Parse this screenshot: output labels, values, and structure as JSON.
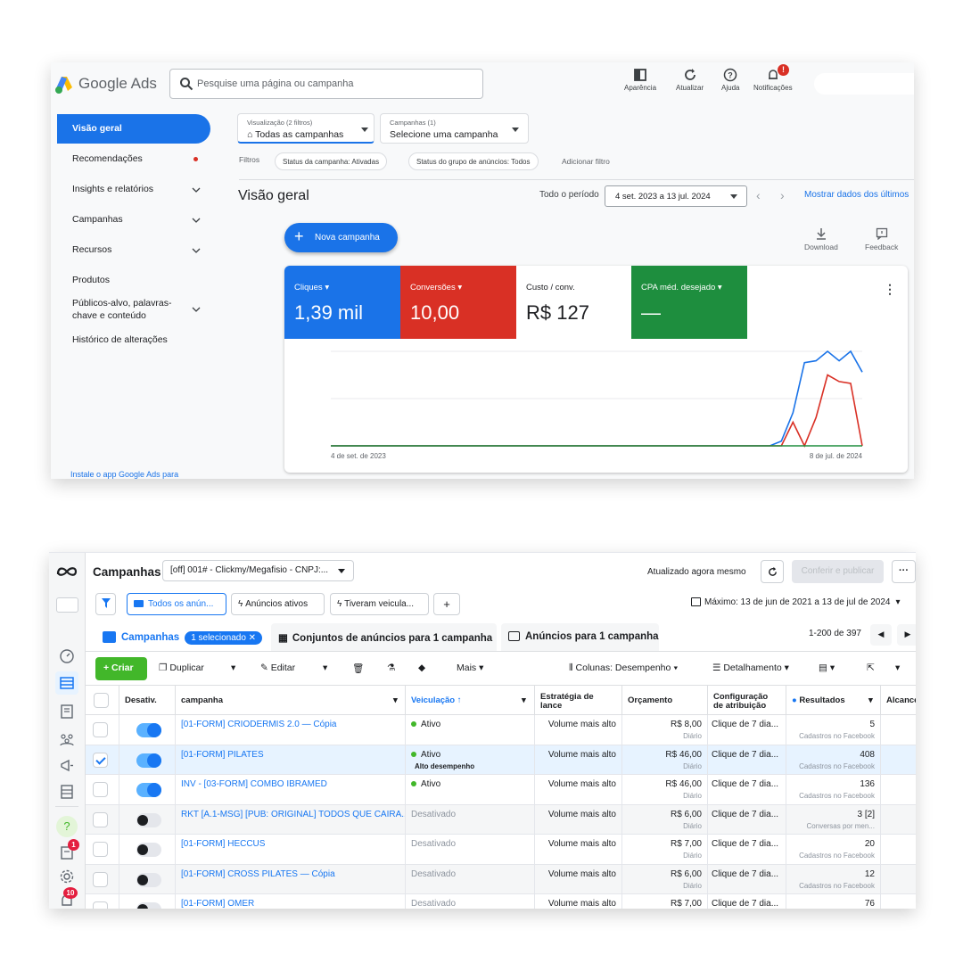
{
  "google_ads": {
    "brand": "Google Ads",
    "search_placeholder": "Pesquise uma página ou campanha",
    "topbar": {
      "appearance": "Aparência",
      "refresh": "Atualizar",
      "help": "Ajuda",
      "notifications": "Notificações",
      "notifications_badge": "!"
    },
    "sidebar": {
      "active": "Visão geral",
      "items": [
        "Recomendações",
        "Insights e relatórios",
        "Campanhas",
        "Recursos",
        "Produtos",
        "Públicos-alvo, palavras-",
        "chave e conteúdo",
        "Histórico de alterações"
      ],
      "install": "Instale o app Google Ads para"
    },
    "filters": {
      "view_small": "Visualização (2 filtros)",
      "view_value": "Todas as campanhas",
      "campaigns_small": "Campanhas (1)",
      "campaigns_value": "Selecione uma campanha",
      "label": "Filtros",
      "chip1": "Status da campanha: Ativadas",
      "chip2": "Status do grupo de anúncios: Todos",
      "add": "Adicionar filtro"
    },
    "page_title": "Visão geral",
    "period_label": "Todo o período",
    "date_range": "4 set. 2023 a 13 jul. 2024",
    "show_data": "Mostrar dados dos últimos",
    "new_campaign": "Nova campanha",
    "download": "Download",
    "feedback": "Feedback",
    "metrics": [
      {
        "label": "Cliques ▾",
        "value": "1,39 mil",
        "bg": "#1a73e8",
        "fg": "#ffffff"
      },
      {
        "label": "Conversões ▾",
        "value": "10,00",
        "bg": "#d93025",
        "fg": "#ffffff"
      },
      {
        "label": "Custo / conv.",
        "value": "R$ 127",
        "bg": "#ffffff",
        "fg": "#202124"
      },
      {
        "label": "CPA méd. desejado ▾",
        "value": "—",
        "bg": "#1e8e3e",
        "fg": "#ffffff"
      }
    ],
    "chart_data": {
      "type": "line",
      "x_start_label": "4 de set. de 2023",
      "x_end_label": "8 de jul. de 2024",
      "series": [
        {
          "color": "#1a73e8",
          "values": [
            0,
            0,
            0,
            0,
            0,
            0,
            0,
            0,
            0,
            0,
            0,
            0,
            0,
            0,
            0,
            0,
            0,
            0,
            0,
            0,
            0,
            0,
            0,
            0,
            0,
            0,
            0,
            0,
            0,
            0,
            0,
            0,
            0,
            0,
            0,
            0,
            0,
            0,
            0,
            0.05,
            0.35,
            0.88,
            0.9,
            1.0,
            0.9,
            1.0,
            0.78
          ]
        },
        {
          "color": "#d93025",
          "values": [
            0,
            0,
            0,
            0,
            0,
            0,
            0,
            0,
            0,
            0,
            0,
            0,
            0,
            0,
            0,
            0,
            0,
            0,
            0,
            0,
            0,
            0,
            0,
            0,
            0,
            0,
            0,
            0,
            0,
            0,
            0,
            0,
            0,
            0,
            0,
            0,
            0,
            0,
            0,
            0,
            0.25,
            0.0,
            0.3,
            0.75,
            0.68,
            0.66,
            0.0
          ]
        },
        {
          "color": "#1e8e3e",
          "values": [
            0,
            0,
            0,
            0,
            0,
            0,
            0,
            0,
            0,
            0,
            0,
            0,
            0,
            0,
            0,
            0,
            0,
            0,
            0,
            0,
            0,
            0,
            0,
            0,
            0,
            0,
            0,
            0,
            0,
            0,
            0,
            0,
            0,
            0,
            0,
            0,
            0,
            0,
            0,
            0,
            0,
            0,
            0,
            0,
            0,
            0,
            0
          ]
        }
      ]
    }
  },
  "meta": {
    "title": "Campanhas",
    "account": "[off] 001# - Clickmy/Megafisio - CNPJ:...",
    "updated": "Atualizado agora mesmo",
    "publish": "Conferir e publicar",
    "more": "···",
    "filter_buttons": [
      "Todos os anún...",
      "Anúncios ativos",
      "Tiveram veicula..."
    ],
    "add_filter": "+",
    "date_range": "Máximo: 13 de jun de 2021 a 13 de jul de 2024",
    "tabs": {
      "campaigns": "Campanhas",
      "selected": "1 selecionado",
      "adsets": "Conjuntos de anúncios para 1 campanha",
      "ads": "Anúncios para 1 campanha"
    },
    "pager": "1-200 de 397",
    "toolbar": {
      "create": "+ Criar",
      "duplicate": "Duplicar",
      "edit": "Editar",
      "more": "Mais",
      "columns": "Colunas: Desempenho",
      "breakdown": "Detalhamento"
    },
    "rail_badges": {
      "notifications": "1",
      "alerts": "10"
    },
    "columns": {
      "off": "Desativ.",
      "campaign": "campanha",
      "delivery": "Veiculação ↑",
      "bid_1": "Estratégia de",
      "bid_2": "lance",
      "budget": "Orçamento",
      "attr_1": "Configuração",
      "attr_2": "de atribuição",
      "results": "Resultados",
      "reach": "Alcance"
    },
    "rows": [
      {
        "name": "[01-FORM] CRIODERMIS 2.0 — Cópia",
        "status": "Ativo",
        "status_sub": "",
        "on": true,
        "checked": false,
        "bid": "Volume mais alto",
        "budget": "R$ 8,00",
        "budget_sub": "Diário",
        "attr": "Clique de 7 dia...",
        "result": "5",
        "result_sub": "Cadastros no Facebook"
      },
      {
        "name": "[01-FORM] PILATES",
        "status": "Ativo",
        "status_sub": "Alto desempenho",
        "on": true,
        "checked": true,
        "bid": "Volume mais alto",
        "budget": "R$ 46,00",
        "budget_sub": "Diário",
        "attr": "Clique de 7 dia...",
        "result": "408",
        "result_sub": "Cadastros no Facebook"
      },
      {
        "name": "INV - [03-FORM] COMBO IBRAMED",
        "status": "Ativo",
        "status_sub": "",
        "on": true,
        "checked": false,
        "bid": "Volume mais alto",
        "budget": "R$ 46,00",
        "budget_sub": "Diário",
        "attr": "Clique de 7 dia...",
        "result": "136",
        "result_sub": "Cadastros no Facebook"
      },
      {
        "name": "RKT [A.1-MSG] [PUB: ORIGINAL] TODOS QUE CAIRA...",
        "status": "Desativado",
        "status_sub": "",
        "on": false,
        "checked": false,
        "bid": "Volume mais alto",
        "budget": "R$ 6,00",
        "budget_sub": "Diário",
        "attr": "Clique de 7 dia...",
        "result": "3 [2]",
        "result_sub": "Conversas por men..."
      },
      {
        "name": "[01-FORM] HECCUS",
        "status": "Desativado",
        "status_sub": "",
        "on": false,
        "checked": false,
        "bid": "Volume mais alto",
        "budget": "R$ 7,00",
        "budget_sub": "Diário",
        "attr": "Clique de 7 dia...",
        "result": "20",
        "result_sub": "Cadastros no Facebook"
      },
      {
        "name": "[01-FORM] CROSS PILATES — Cópia",
        "status": "Desativado",
        "status_sub": "",
        "on": false,
        "checked": false,
        "bid": "Volume mais alto",
        "budget": "R$ 6,00",
        "budget_sub": "Diário",
        "attr": "Clique de 7 dia...",
        "result": "12",
        "result_sub": "Cadastros no Facebook"
      },
      {
        "name": "[01-FORM] OMER",
        "status": "Desativado",
        "status_sub": "",
        "on": false,
        "checked": false,
        "bid": "Volume mais alto",
        "budget": "R$ 7,00",
        "budget_sub": "",
        "attr": "Clique de 7 dia...",
        "result": "76",
        "result_sub": ""
      }
    ]
  }
}
